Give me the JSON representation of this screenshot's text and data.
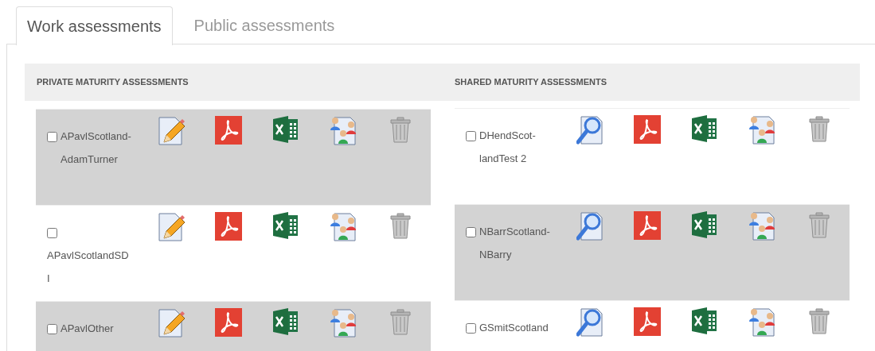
{
  "tabs": [
    {
      "label": "Work assessments",
      "selected": true
    },
    {
      "label": "Public assessments",
      "selected": false
    }
  ],
  "sections": [
    {
      "title": "PRIVATE MATURITY ASSESSMENTS",
      "rows": [
        {
          "name": [
            "APavlScotland-",
            "AdamTurner"
          ],
          "checked": false,
          "shaded": true,
          "actions": [
            {
              "kind": "edit"
            },
            {
              "kind": "pdf"
            },
            {
              "kind": "excel"
            },
            {
              "kind": "share"
            },
            {
              "kind": "delete"
            }
          ]
        },
        {
          "name": [
            "APavlScotlandSD",
            "I"
          ],
          "checked": false,
          "shaded": false,
          "actions": [
            {
              "kind": "edit"
            },
            {
              "kind": "pdf"
            },
            {
              "kind": "excel"
            },
            {
              "kind": "share"
            },
            {
              "kind": "delete"
            }
          ]
        },
        {
          "name": [
            "APavlOther"
          ],
          "checked": false,
          "shaded": true,
          "actions": [
            {
              "kind": "edit"
            },
            {
              "kind": "pdf"
            },
            {
              "kind": "excel"
            },
            {
              "kind": "share"
            },
            {
              "kind": "delete"
            }
          ]
        }
      ]
    },
    {
      "title": "SHARED MATURITY ASSESSMENTS",
      "rows": [
        {
          "name": [
            "DHendScot-",
            "landTest 2"
          ],
          "checked": false,
          "shaded": false,
          "actions": [
            {
              "kind": "view"
            },
            {
              "kind": "pdf"
            },
            {
              "kind": "excel"
            },
            {
              "kind": "share"
            },
            {
              "kind": "delete"
            }
          ]
        },
        {
          "name": [
            "NBarrScotland-",
            "NBarry"
          ],
          "checked": false,
          "shaded": true,
          "actions": [
            {
              "kind": "view"
            },
            {
              "kind": "pdf"
            },
            {
              "kind": "excel"
            },
            {
              "kind": "share"
            },
            {
              "kind": "delete"
            }
          ]
        },
        {
          "name": [
            "GSmitScotland"
          ],
          "checked": false,
          "shaded": false,
          "actions": [
            {
              "kind": "view"
            },
            {
              "kind": "pdf"
            },
            {
              "kind": "excel"
            },
            {
              "kind": "share"
            },
            {
              "kind": "delete"
            }
          ]
        }
      ]
    }
  ]
}
